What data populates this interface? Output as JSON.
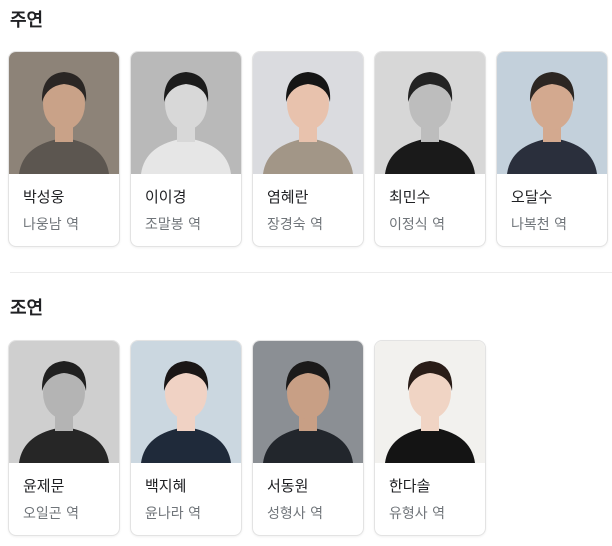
{
  "sections": [
    {
      "title": "주연",
      "cast": [
        {
          "name": "박성웅",
          "role": "나웅남 역",
          "bg": "#8d8378",
          "skin": "#c9a288",
          "hair": "#2a2624",
          "cloth": "#5c5650"
        },
        {
          "name": "이이경",
          "role": "조말봉 역",
          "bg": "#b9b9b9",
          "skin": "#d8d8d8",
          "hair": "#1c1c1c",
          "cloth": "#e6e6e6"
        },
        {
          "name": "염혜란",
          "role": "장경숙 역",
          "bg": "#dadbdf",
          "skin": "#e8c2ad",
          "hair": "#151515",
          "cloth": "#a29687"
        },
        {
          "name": "최민수",
          "role": "이정식 역",
          "bg": "#d7d7d7",
          "skin": "#bdbdbd",
          "hair": "#232323",
          "cloth": "#1a1a1a"
        },
        {
          "name": "오달수",
          "role": "나복천 역",
          "bg": "#c3d0db",
          "skin": "#d3a98f",
          "hair": "#2c2622",
          "cloth": "#2a2f3c"
        }
      ]
    },
    {
      "title": "조연",
      "cast": [
        {
          "name": "윤제문",
          "role": "오일곤 역",
          "bg": "#cfcfcf",
          "skin": "#b4b4b4",
          "hair": "#202020",
          "cloth": "#262626"
        },
        {
          "name": "백지혜",
          "role": "윤나라 역",
          "bg": "#cbd7e0",
          "skin": "#f0d2c4",
          "hair": "#1a1616",
          "cloth": "#1f2a3a"
        },
        {
          "name": "서동원",
          "role": "성형사 역",
          "bg": "#8b8f94",
          "skin": "#c89f85",
          "hair": "#1b1a1a",
          "cloth": "#22262c"
        },
        {
          "name": "한다솔",
          "role": "유형사 역",
          "bg": "#f2f1ee",
          "skin": "#f0d4c4",
          "hair": "#2a1d18",
          "cloth": "#141414"
        }
      ]
    }
  ]
}
